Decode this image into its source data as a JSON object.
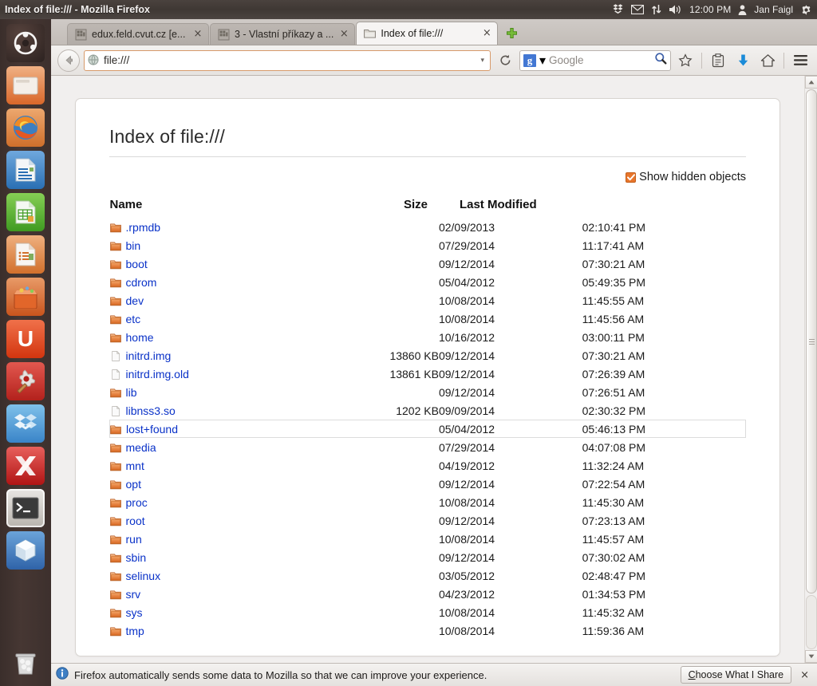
{
  "window": {
    "title": "Index of file:/// - Mozilla Firefox"
  },
  "tray": {
    "icons": [
      "dropbox-icon",
      "mail-icon",
      "network-icon",
      "volume-icon"
    ],
    "clock": "12:00 PM",
    "user_icon": "user-icon",
    "user_name": "Jan Faigl",
    "settings_icon": "gear-icon"
  },
  "launcher": {
    "items": [
      {
        "name": "ubuntu-dash-icon",
        "label": "Dash home"
      },
      {
        "name": "files-icon",
        "label": "Files"
      },
      {
        "name": "firefox-icon",
        "label": "Firefox Web Browser"
      },
      {
        "name": "libreoffice-writer-icon",
        "label": "LibreOffice Writer"
      },
      {
        "name": "libreoffice-calc-icon",
        "label": "LibreOffice Calc"
      },
      {
        "name": "libreoffice-impress-icon",
        "label": "LibreOffice Impress"
      },
      {
        "name": "ubuntu-software-center-icon",
        "label": "Ubuntu Software Center"
      },
      {
        "name": "ubuntu-one-icon",
        "label": "Ubuntu One"
      },
      {
        "name": "system-settings-icon",
        "label": "System Settings"
      },
      {
        "name": "dropbox-launcher-icon",
        "label": "Dropbox"
      },
      {
        "name": "xmind-icon",
        "label": "XMind"
      },
      {
        "name": "terminal-icon",
        "label": "Terminal"
      },
      {
        "name": "virtualbox-icon",
        "label": "VirtualBox"
      },
      {
        "name": "trash-icon",
        "label": "Trash"
      }
    ]
  },
  "tabs": [
    {
      "label": "edux.feld.cvut.cz [e...",
      "favicon": "page-icon",
      "active": false,
      "close": "×"
    },
    {
      "label": "3 - Vlastní příkazy a ...",
      "favicon": "page-icon",
      "active": false,
      "close": "×"
    },
    {
      "label": "Index of file:///",
      "favicon": "folder-icon",
      "active": true,
      "close": "×"
    }
  ],
  "newtab_label": "+",
  "toolbar": {
    "back_icon": "back-arrow-icon",
    "url_icon": "globe-icon",
    "url_value": "file:///",
    "url_dropmarker": "▾",
    "reload_icon": "reload-icon",
    "search_engine_badge": "g",
    "search_engine_dropmarker": "▾",
    "search_placeholder": "Google",
    "search_icon": "magnifier-icon",
    "bookmark_icon": "star-icon",
    "reader_icon": "reader-list-icon",
    "downloads_icon": "download-arrow-icon",
    "home_icon": "home-icon",
    "menu_icon": "hamburger-menu-icon"
  },
  "content": {
    "heading": "Index of file:///",
    "show_hidden_label": "Show hidden objects",
    "show_hidden_checked": true,
    "columns": {
      "name": "Name",
      "size": "Size",
      "modified": "Last Modified"
    },
    "rows": [
      {
        "icon": "folder-icon",
        "name": ".rpmdb",
        "size": "",
        "date": "02/09/2013",
        "time": "02:10:41 PM",
        "hovered": false
      },
      {
        "icon": "folder-icon",
        "name": "bin",
        "size": "",
        "date": "07/29/2014",
        "time": "11:17:41 AM",
        "hovered": false
      },
      {
        "icon": "folder-icon",
        "name": "boot",
        "size": "",
        "date": "09/12/2014",
        "time": "07:30:21 AM",
        "hovered": false
      },
      {
        "icon": "folder-icon",
        "name": "cdrom",
        "size": "",
        "date": "05/04/2012",
        "time": "05:49:35 PM",
        "hovered": false
      },
      {
        "icon": "folder-icon",
        "name": "dev",
        "size": "",
        "date": "10/08/2014",
        "time": "11:45:55 AM",
        "hovered": false
      },
      {
        "icon": "folder-icon",
        "name": "etc",
        "size": "",
        "date": "10/08/2014",
        "time": "11:45:56 AM",
        "hovered": false
      },
      {
        "icon": "folder-icon",
        "name": "home",
        "size": "",
        "date": "10/16/2012",
        "time": "03:00:11 PM",
        "hovered": false
      },
      {
        "icon": "file-icon",
        "name": "initrd.img",
        "size": "13860 KB",
        "date": "09/12/2014",
        "time": "07:30:21 AM",
        "hovered": false
      },
      {
        "icon": "file-icon",
        "name": "initrd.img.old",
        "size": "13861 KB",
        "date": "09/12/2014",
        "time": "07:26:39 AM",
        "hovered": false
      },
      {
        "icon": "folder-icon",
        "name": "lib",
        "size": "",
        "date": "09/12/2014",
        "time": "07:26:51 AM",
        "hovered": false
      },
      {
        "icon": "file-icon",
        "name": "libnss3.so",
        "size": "1202 KB",
        "date": "09/09/2014",
        "time": "02:30:32 PM",
        "hovered": false
      },
      {
        "icon": "folder-icon",
        "name": "lost+found",
        "size": "",
        "date": "05/04/2012",
        "time": "05:46:13 PM",
        "hovered": true
      },
      {
        "icon": "folder-icon",
        "name": "media",
        "size": "",
        "date": "07/29/2014",
        "time": "04:07:08 PM",
        "hovered": false
      },
      {
        "icon": "folder-icon",
        "name": "mnt",
        "size": "",
        "date": "04/19/2012",
        "time": "11:32:24 AM",
        "hovered": false
      },
      {
        "icon": "folder-icon",
        "name": "opt",
        "size": "",
        "date": "09/12/2014",
        "time": "07:22:54 AM",
        "hovered": false
      },
      {
        "icon": "folder-icon",
        "name": "proc",
        "size": "",
        "date": "10/08/2014",
        "time": "11:45:30 AM",
        "hovered": false
      },
      {
        "icon": "folder-icon",
        "name": "root",
        "size": "",
        "date": "09/12/2014",
        "time": "07:23:13 AM",
        "hovered": false
      },
      {
        "icon": "folder-icon",
        "name": "run",
        "size": "",
        "date": "10/08/2014",
        "time": "11:45:57 AM",
        "hovered": false
      },
      {
        "icon": "folder-icon",
        "name": "sbin",
        "size": "",
        "date": "09/12/2014",
        "time": "07:30:02 AM",
        "hovered": false
      },
      {
        "icon": "folder-icon",
        "name": "selinux",
        "size": "",
        "date": "03/05/2012",
        "time": "02:48:47 PM",
        "hovered": false
      },
      {
        "icon": "folder-icon",
        "name": "srv",
        "size": "",
        "date": "04/23/2012",
        "time": "01:34:53 PM",
        "hovered": false
      },
      {
        "icon": "folder-icon",
        "name": "sys",
        "size": "",
        "date": "10/08/2014",
        "time": "11:45:32 AM",
        "hovered": false
      },
      {
        "icon": "folder-icon",
        "name": "tmp",
        "size": "",
        "date": "10/08/2014",
        "time": "11:59:36 AM",
        "hovered": false
      }
    ]
  },
  "notification": {
    "info_icon": "info-icon",
    "message": "Firefox automatically sends some data to Mozilla so that we can improve your experience.",
    "button_label": "Choose What I Share",
    "close_label": "×"
  },
  "colors": {
    "link": "#0a32c8",
    "folder": "#e8762c",
    "accent": "#dd4814",
    "panel": "#3f3834",
    "page_bg": "#f1efee"
  }
}
